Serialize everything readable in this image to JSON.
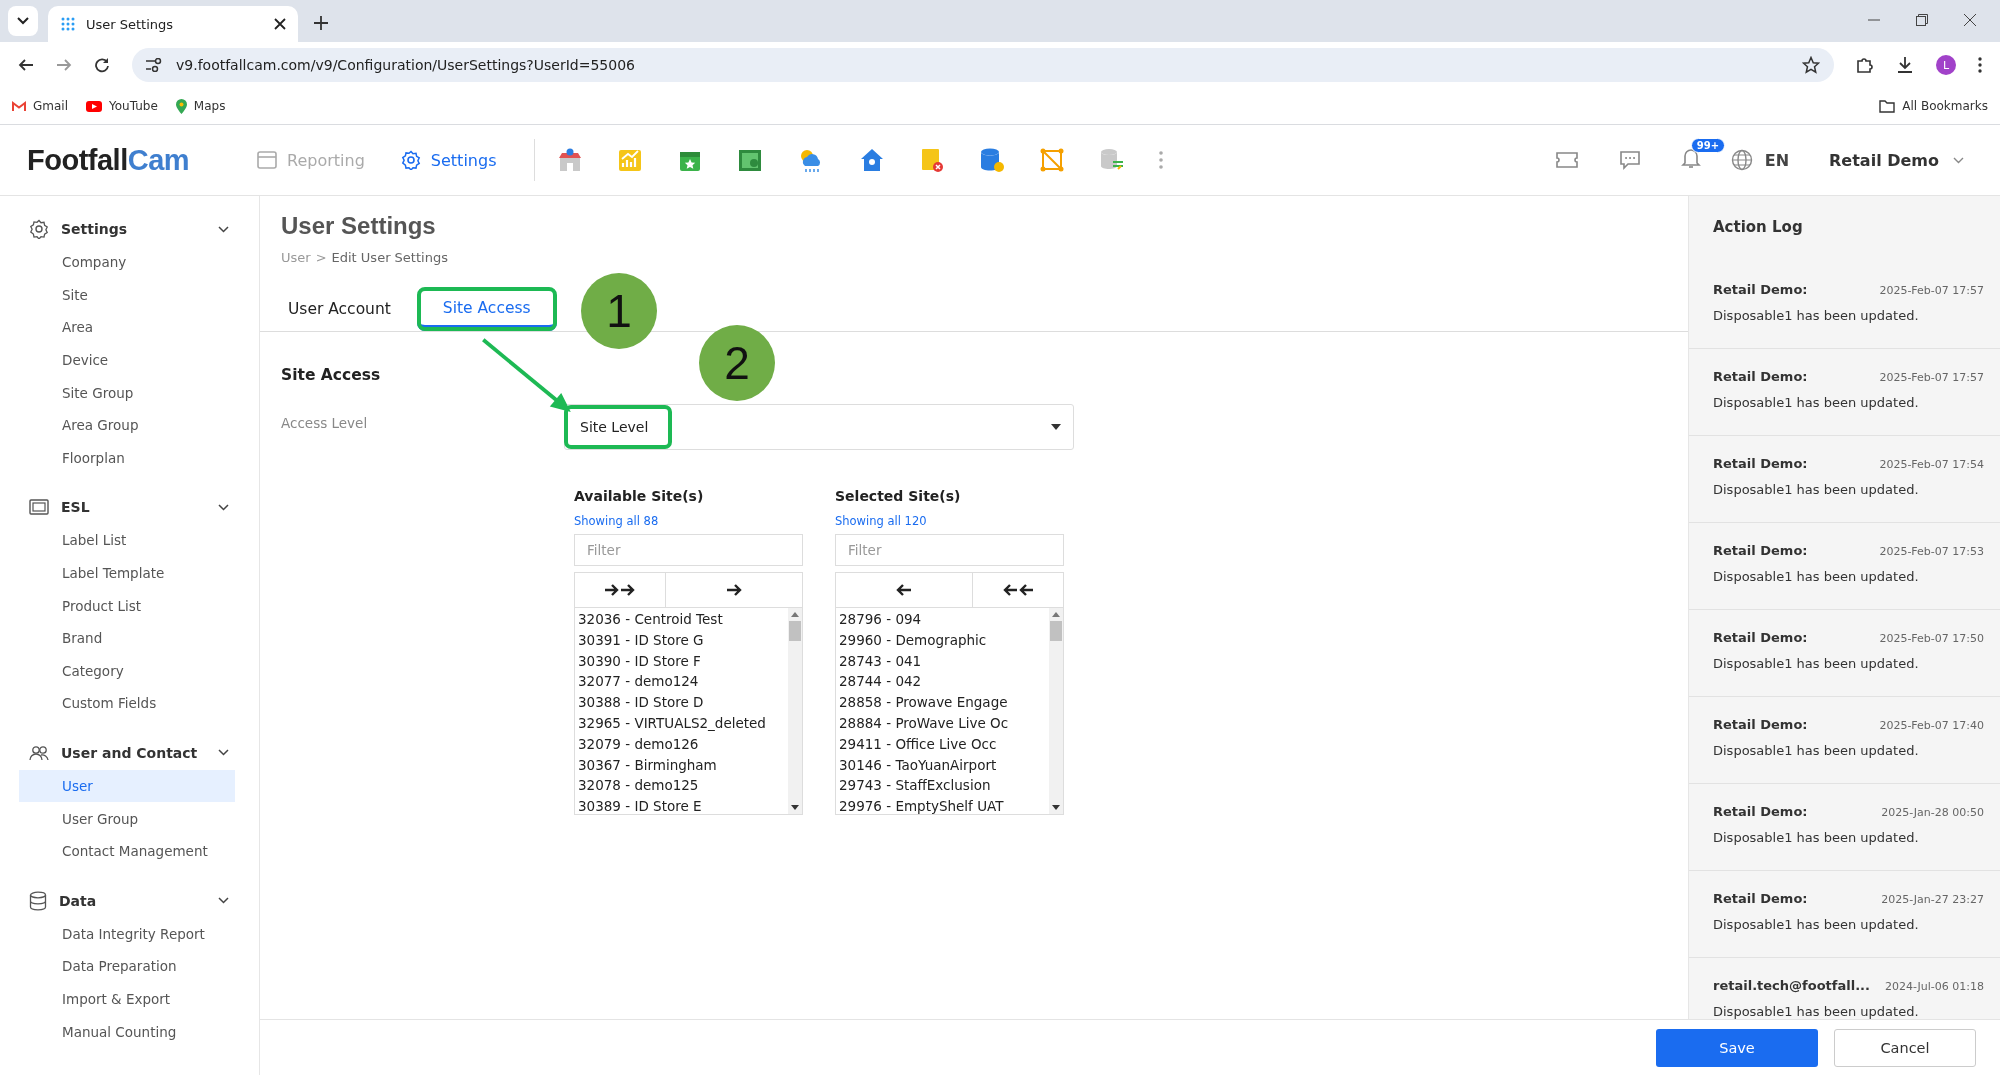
{
  "browser": {
    "tab_title": "User Settings",
    "url": "v9.footfallcam.com/v9/Configuration/UserSettings?UserId=55006",
    "bookmarks": [
      {
        "label": "Gmail",
        "kind": "gmail"
      },
      {
        "label": "YouTube",
        "kind": "youtube"
      },
      {
        "label": "Maps",
        "kind": "maps"
      }
    ],
    "all_bookmarks": "All Bookmarks",
    "profile_initial": "L"
  },
  "header": {
    "logo": {
      "first": "Footfall",
      "second": "Cam"
    },
    "nav": [
      {
        "label": "Reporting",
        "kind": "calendar",
        "selected": false
      },
      {
        "label": "Settings",
        "kind": "gear",
        "selected": true
      }
    ],
    "notification_badge": "99+",
    "language": "EN",
    "user": "Retail Demo"
  },
  "sidebar": {
    "groups": [
      {
        "title": "Settings",
        "kind": "gear",
        "expanded": true,
        "items": [
          {
            "label": "Company",
            "selected": false
          },
          {
            "label": "Site",
            "selected": false
          },
          {
            "label": "Area",
            "selected": false
          },
          {
            "label": "Device",
            "selected": false
          },
          {
            "label": "Site Group",
            "selected": false
          },
          {
            "label": "Area Group",
            "selected": false
          },
          {
            "label": "Floorplan",
            "selected": false
          }
        ]
      },
      {
        "title": "ESL",
        "kind": "screen",
        "expanded": true,
        "items": [
          {
            "label": "Label List",
            "selected": false
          },
          {
            "label": "Label Template",
            "selected": false
          },
          {
            "label": "Product List",
            "selected": false
          },
          {
            "label": "Brand",
            "selected": false
          },
          {
            "label": "Category",
            "selected": false
          },
          {
            "label": "Custom Fields",
            "selected": false
          }
        ]
      },
      {
        "title": "User and Contact",
        "kind": "users",
        "expanded": true,
        "items": [
          {
            "label": "User",
            "selected": true
          },
          {
            "label": "User Group",
            "selected": false
          },
          {
            "label": "Contact Management",
            "selected": false
          }
        ]
      },
      {
        "title": "Data",
        "kind": "database",
        "expanded": true,
        "items": [
          {
            "label": "Data Integrity Report",
            "selected": false
          },
          {
            "label": "Data Preparation",
            "selected": false
          },
          {
            "label": "Import & Export",
            "selected": false
          },
          {
            "label": "Manual Counting",
            "selected": false
          }
        ]
      }
    ]
  },
  "page": {
    "title": "User Settings",
    "breadcrumb": [
      "User",
      ">",
      "Edit User Settings"
    ],
    "tabs": [
      {
        "label": "User Account",
        "selected": false,
        "highlighted": false
      },
      {
        "label": "Site Access",
        "selected": true,
        "highlighted": true
      }
    ],
    "section_title": "Site Access",
    "access_level": {
      "label": "Access Level",
      "value": "Site Level",
      "highlighted": true
    },
    "callouts": [
      "1",
      "2"
    ],
    "lists": [
      {
        "title": "Available Site(s)",
        "count_text": "Showing all 88",
        "filter_placeholder": "Filter",
        "kind": "add",
        "items": [
          "32036 - Centroid Test",
          "30391 - ID Store G",
          "30390 - ID Store F",
          "32077 - demo124",
          "30388 - ID Store D",
          "32965 - VIRTUALS2_deleted",
          "32079 - demo126",
          "30367 - Birmingham",
          "32078 - demo125",
          "30389 - ID Store E"
        ]
      },
      {
        "title": "Selected Site(s)",
        "count_text": "Showing all 120",
        "filter_placeholder": "Filter",
        "kind": "remove",
        "items": [
          "28796 - 094",
          "29960 - Demographic",
          "28743 - 041",
          "28744 - 042",
          "28858 - Prowave Engage",
          "28884 - ProWave Live Oc",
          "29411 - Office Live Occ",
          "30146 - TaoYuanAirport",
          "29743 - StaffExclusion",
          "29976 - EmptyShelf UAT"
        ]
      }
    ]
  },
  "action_log": {
    "title": "Action Log",
    "entries": [
      {
        "user": "Retail Demo:",
        "time": "2025-Feb-07 17:57",
        "message": "Disposable1 has been updated."
      },
      {
        "user": "Retail Demo:",
        "time": "2025-Feb-07 17:57",
        "message": "Disposable1 has been updated."
      },
      {
        "user": "Retail Demo:",
        "time": "2025-Feb-07 17:54",
        "message": "Disposable1 has been updated."
      },
      {
        "user": "Retail Demo:",
        "time": "2025-Feb-07 17:53",
        "message": "Disposable1 has been updated."
      },
      {
        "user": "Retail Demo:",
        "time": "2025-Feb-07 17:50",
        "message": "Disposable1 has been updated."
      },
      {
        "user": "Retail Demo:",
        "time": "2025-Feb-07 17:40",
        "message": "Disposable1 has been updated."
      },
      {
        "user": "Retail Demo:",
        "time": "2025-Jan-28 00:50",
        "message": "Disposable1 has been updated."
      },
      {
        "user": "Retail Demo:",
        "time": "2025-Jan-27 23:27",
        "message": "Disposable1 has been updated."
      },
      {
        "user": "retail.tech@footfall...",
        "time": "2024-Jul-06 01:18",
        "message": "Disposable1 has been updated."
      }
    ]
  },
  "buttons": {
    "save": "Save",
    "cancel": "Cancel"
  }
}
